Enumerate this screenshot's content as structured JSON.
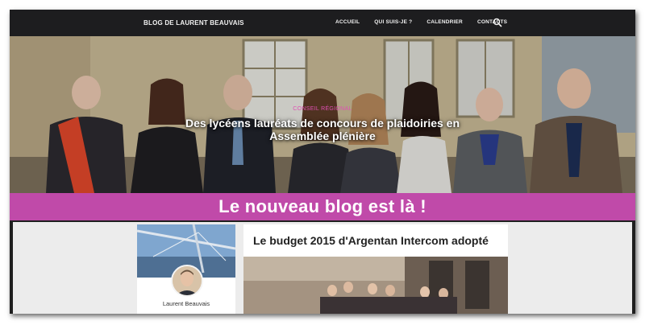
{
  "site": {
    "brand": "BLOG DE LAURENT BEAUVAIS",
    "nav": [
      "ACCUEIL",
      "QUI SUIS-JE ?",
      "CALENDRIER",
      "CONTACTS"
    ],
    "search_icon": "search-icon"
  },
  "hero": {
    "category": "CONSEIL RÉGIONAL",
    "title": "Des lycéens lauréats de concours de plaidoiries en Assemblée plénière"
  },
  "banner": {
    "text": "Le nouveau blog est là !"
  },
  "sidebar": {
    "author_name": "Laurent Beauvais"
  },
  "post": {
    "title": "Le budget 2015 d'Argentan Intercom adopté"
  },
  "colors": {
    "accent": "#c04aa9",
    "category": "#e04fb3",
    "navbar": "#1d1d1f"
  }
}
